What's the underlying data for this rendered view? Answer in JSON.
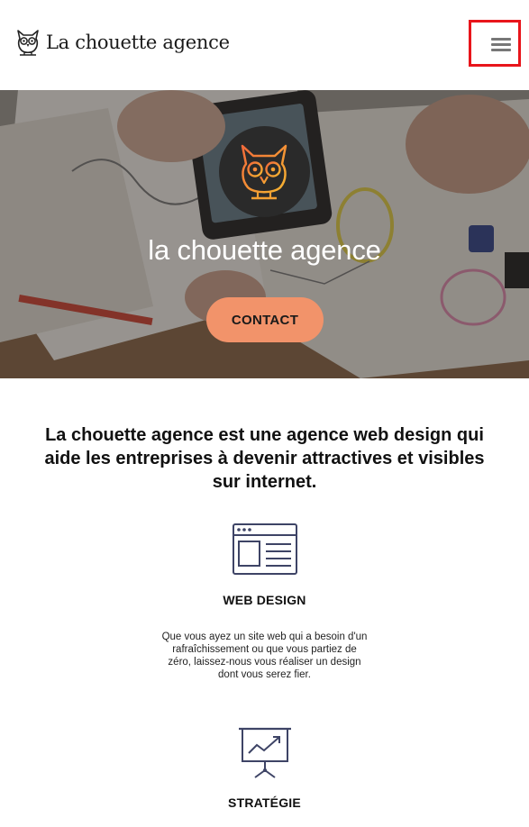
{
  "header": {
    "brand_name": "La chouette agence",
    "menu_icon": "hamburger-menu-icon",
    "menu_highlight_color": "#e8151b"
  },
  "hero": {
    "title": "la chouette agence",
    "cta_label": "CONTACT",
    "cta_color": "#f2936a",
    "logo_icon": "owl-logo-icon"
  },
  "intro": {
    "text": "La chouette agence est une agence web design qui aide les entreprises à devenir attractives et visibles sur internet."
  },
  "services": [
    {
      "icon": "web-design-icon",
      "title": "WEB DESIGN",
      "description": "Que vous ayez un site web qui a besoin d'un rafraîchissement ou que vous partiez de zéro, laissez-nous vous réaliser un design dont vous serez fier."
    },
    {
      "icon": "strategy-chart-icon",
      "title": "STRATÉGIE"
    }
  ]
}
